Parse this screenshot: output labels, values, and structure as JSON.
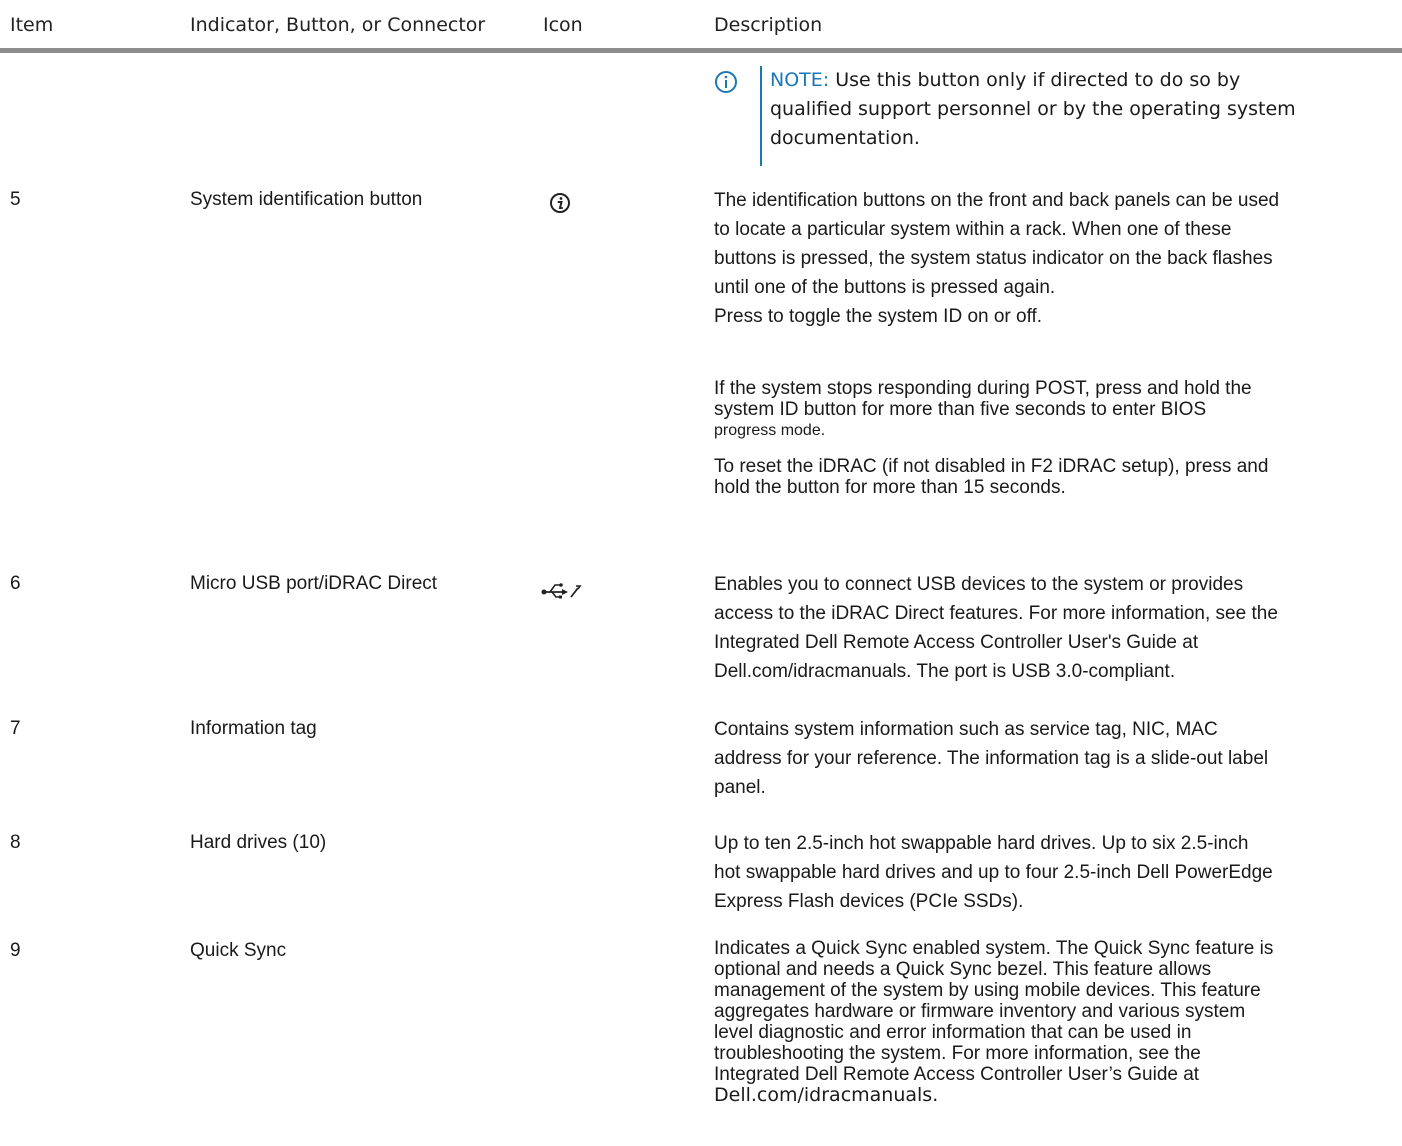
{
  "headers": {
    "item": "Item",
    "indicator": "Indicator, Button, or Connector",
    "icon": "Icon",
    "description": "Description"
  },
  "note": {
    "label": "NOTE:",
    "line1": "Use this button only if directed to do so by",
    "line2": "qualified support personnel or by the operating system",
    "line3": "documentation.",
    "icon": "info-circle-icon",
    "accent_color": "#1a78b4"
  },
  "rows": [
    {
      "item": "5",
      "name": "System identification button",
      "icon": "system-id-icon",
      "desc": [
        "The identification buttons on the front and back panels can be used",
        "to locate a particular system within a rack. When one of these",
        "buttons is pressed, the system status indicator on the back flashes",
        "until one of the buttons is pressed again.",
        "Press to toggle the system ID on or off."
      ],
      "desc2": [
        "If the system stops responding during POST, press and hold the",
        "system ID button for more than five seconds to enter BIOS",
        "progress mode."
      ],
      "desc3": [
        "To reset the iDRAC (if not disabled in F2 iDRAC setup), press and",
        "hold the button for more than 15 seconds."
      ]
    },
    {
      "item": "6",
      "name": "Micro USB port/iDRAC Direct",
      "icon": "usb-wrench-icon",
      "desc": [
        "Enables you to connect USB devices to the system or provides",
        "access to the iDRAC Direct features. For more information, see the",
        "Integrated Dell Remote Access Controller User's Guide at",
        "Dell.com/idracmanuals. The port is USB 3.0-compliant."
      ]
    },
    {
      "item": "7",
      "name": "Information tag",
      "desc": [
        "Contains system information such as service tag, NIC, MAC",
        "address for your reference. The information tag is a slide-out label",
        "panel."
      ]
    },
    {
      "item": "8",
      "name": "Hard drives (10)",
      "desc": [
        "Up to ten 2.5-inch hot swappable hard drives. Up to six 2.5-inch",
        "hot swappable hard drives and up to four 2.5-inch Dell PowerEdge",
        "Express Flash devices (PCIe SSDs)."
      ]
    },
    {
      "item": "9",
      "name": "Quick Sync",
      "desc": [
        "Indicates a Quick Sync enabled system. The Quick Sync feature is",
        "optional and needs a Quick Sync bezel. This feature allows",
        "management of the system by using mobile devices. This feature",
        "aggregates hardware or firmware inventory and various system",
        "level diagnostic and error information that can be used in",
        "troubleshooting the system. For more information, see the",
        "Integrated Dell Remote Access Controller User’s Guide at",
        "Dell.com/idracmanuals."
      ]
    }
  ]
}
